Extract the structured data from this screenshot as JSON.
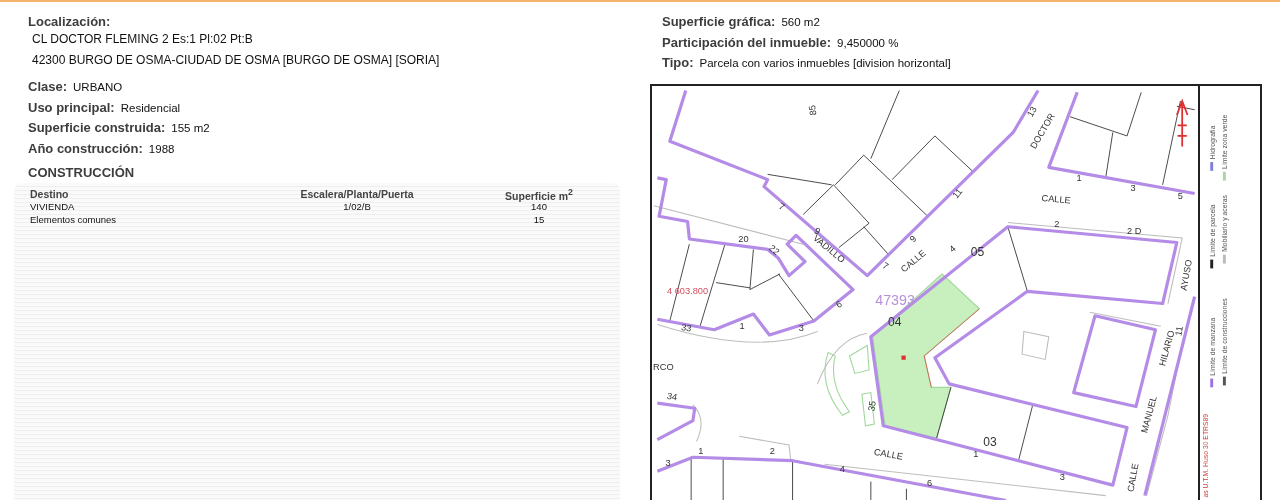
{
  "location": {
    "label": "Localización:",
    "lines": [
      "CL DOCTOR FLEMING 2 Es:1 Pl:02 Pt:B",
      "42300 BURGO DE OSMA-CIUDAD DE OSMA [BURGO DE OSMA] [SORIA]"
    ]
  },
  "fields": [
    {
      "label": "Clase:",
      "value": "URBANO"
    },
    {
      "label": "Uso principal:",
      "value": "Residencial"
    },
    {
      "label": "Superficie construida:",
      "value": "155 m2"
    },
    {
      "label": "Año construcción:",
      "value": "1988"
    }
  ],
  "construction": {
    "title": "CONSTRUCCIÓN",
    "columns": [
      "Destino",
      "Escalera/Planta/Puerta",
      "Superficie m$^{2}$"
    ],
    "rows": [
      {
        "destination": "VIVIENDA",
        "stair_floor_door": "1/02/B",
        "area": "140"
      },
      {
        "destination": "Elementos comunes",
        "area": "15"
      }
    ]
  },
  "parcel": {
    "fields": [
      {
        "label": "Superficie gráfica:",
        "value": "560 m2"
      },
      {
        "label": "Participación del inmueble:",
        "value": "9,450000 %"
      },
      {
        "label": "Tipo:",
        "value": "Parcela con varios inmuebles [division horizontal]"
      }
    ]
  },
  "map": {
    "labels": [
      "85",
      "13",
      "DOCTOR",
      "7",
      "11",
      "CALLE",
      "1",
      "3",
      "5",
      "9",
      "VADILLO",
      "9",
      "20",
      "22",
      "7",
      "CALLE",
      "4",
      "05",
      "2",
      "2 D",
      "AYUSO",
      "4 603.800",
      "47393",
      "6",
      "04",
      "33",
      "1",
      "3",
      "HILARIO",
      "11",
      "RCO",
      "34",
      "35",
      "03",
      "MANUEL",
      "CALLE",
      "1",
      "3",
      "CALLE",
      "1",
      "2",
      "3",
      "4",
      "6"
    ],
    "legend": [
      {
        "label": "Límite de manzana",
        "color": "#a070e0"
      },
      {
        "label": "Límite de construcciones",
        "color": "#555555"
      },
      {
        "label": "Límite de parcela",
        "color": "#222222"
      },
      {
        "label": "Mobiliario y aceras",
        "color": "#bbbbbb"
      },
      {
        "label": "Hidrografía",
        "color": "#7f7fd8"
      },
      {
        "label": "Límite zona verde",
        "color": "#a8d8a0"
      }
    ],
    "coordinate_note": "as U.T.M. Huso 30 ETRS89"
  }
}
